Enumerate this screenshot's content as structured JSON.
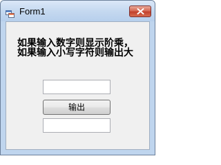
{
  "window": {
    "title": "Form1",
    "close_glyph": "✕"
  },
  "form": {
    "description_line1": "如果输入数字则显示阶乘，",
    "description_line2": "如果输入小写字符则输出大",
    "input_value": "",
    "button_label": "输出",
    "output_value": ""
  },
  "icons": {
    "app": "app-window-icon",
    "close": "close-icon"
  },
  "colors": {
    "titlebar": "#c5d9f0",
    "client_bg": "#f0f0f0",
    "close_button": "#c2412c"
  }
}
